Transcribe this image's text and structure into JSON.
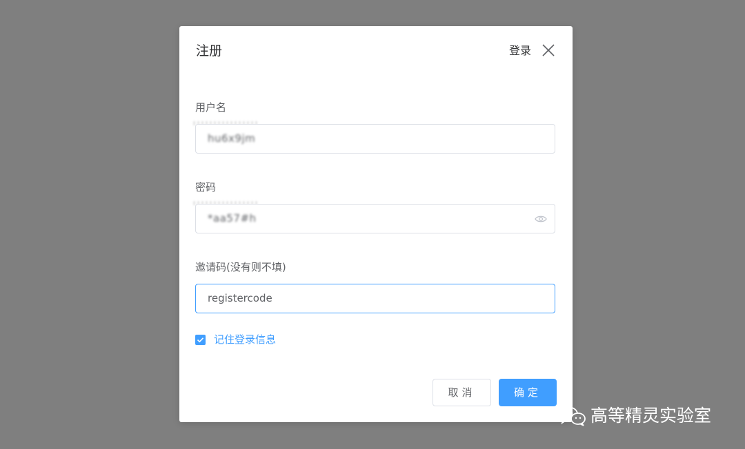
{
  "dialog": {
    "title": "注册",
    "login_link": "登录",
    "close_icon": "close-icon"
  },
  "form": {
    "username": {
      "label": "用户名",
      "value": "hu6x9jm"
    },
    "password": {
      "label": "密码",
      "value": "*aa57#h",
      "toggle_icon": "eye-icon"
    },
    "invite_code": {
      "label": "邀请码(没有则不填)",
      "value": "registercode"
    },
    "remember": {
      "label": "记住登录信息",
      "checked": true
    }
  },
  "buttons": {
    "cancel_label": "取消",
    "confirm_label": "确定"
  },
  "watermark": {
    "icon": "wechat-icon",
    "text": "高等精灵实验室"
  },
  "colors": {
    "accent": "#409eff",
    "backdrop": "#7f7f7f"
  }
}
